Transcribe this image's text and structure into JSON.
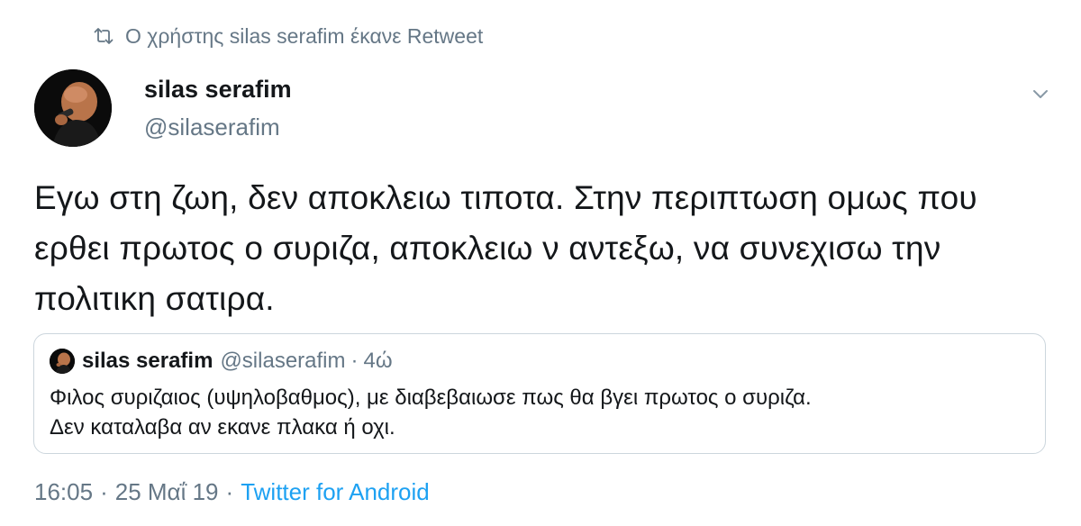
{
  "retweet": {
    "icon": "retweet-icon",
    "text": "Ο χρήστης silas serafim έκανε Retweet"
  },
  "tweet": {
    "author": {
      "name": "silas serafim",
      "handle": "@silaserafim",
      "avatar": "avatar-photo"
    },
    "menu_icon": "chevron-down-icon",
    "text": "Εγω στη ζωη, δεν αποκλειω τιποτα. Στην περιπτωση ομως που ερθει πρωτος ο συριζα, αποκλειω ν αντεξω, να συνεχισω την πολιτικη σατιρα.",
    "quoted": {
      "name": "silas serafim",
      "handle": "@silaserafim",
      "separator": "·",
      "time": "4ώ",
      "text_line1": "Φιλος συριζαιος (υψηλοβαθμος), με διαβεβαιωσε πως θα βγει πρωτος ο συριζα.",
      "text_line2": "Δεν καταλαβα αν εκανε πλακα ή οχι."
    },
    "meta": {
      "time": "16:05",
      "separator": "·",
      "date": "25 Μαΐ 19",
      "source": "Twitter for Android"
    }
  },
  "colors": {
    "text": "#14171a",
    "secondary": "#657786",
    "link": "#1da1f2",
    "border": "#ccd6dd"
  }
}
